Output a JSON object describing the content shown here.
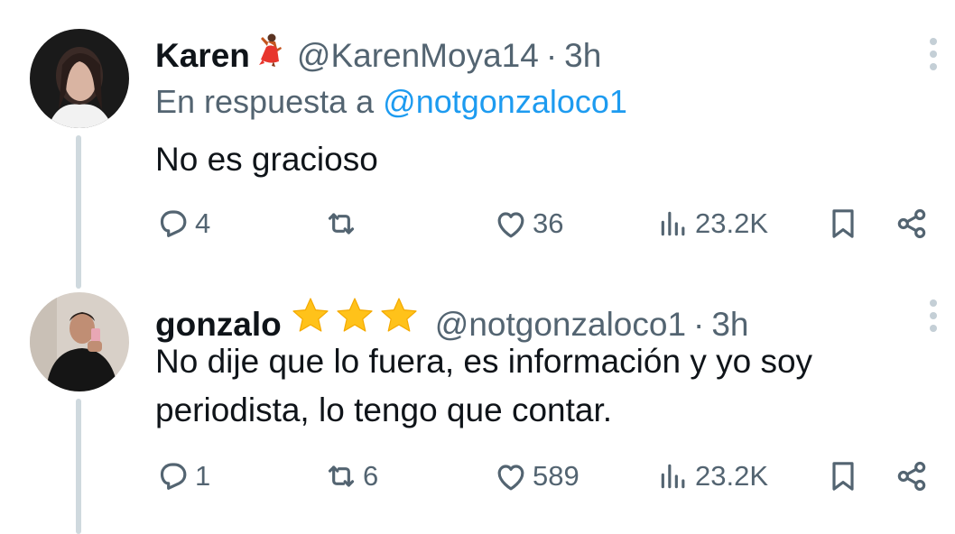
{
  "tweets": [
    {
      "name": "Karen",
      "name_emoji": "💃",
      "handle": "@KarenMoya14",
      "separator": "·",
      "time": "3h",
      "reply_prefix": "En respuesta a",
      "reply_mention": "@notgonzaloco1",
      "text": "No es gracioso",
      "replies": "4",
      "retweets": "",
      "likes": "36",
      "views": "23.2K"
    },
    {
      "name": "gonzalo",
      "name_emoji": "⭐⭐⭐",
      "handle": "@notgonzaloco1",
      "separator": "·",
      "time": "3h",
      "text": "No dije que lo fuera, es información y yo soy periodista, lo tengo que contar.",
      "replies": "1",
      "retweets": "6",
      "likes": "589",
      "views": "23.2K"
    }
  ],
  "colors": {
    "text": "#0f1419",
    "secondary": "#536471",
    "link": "#1d9bf0",
    "thread_line": "#cfd9de",
    "star": "#ffc21a"
  }
}
